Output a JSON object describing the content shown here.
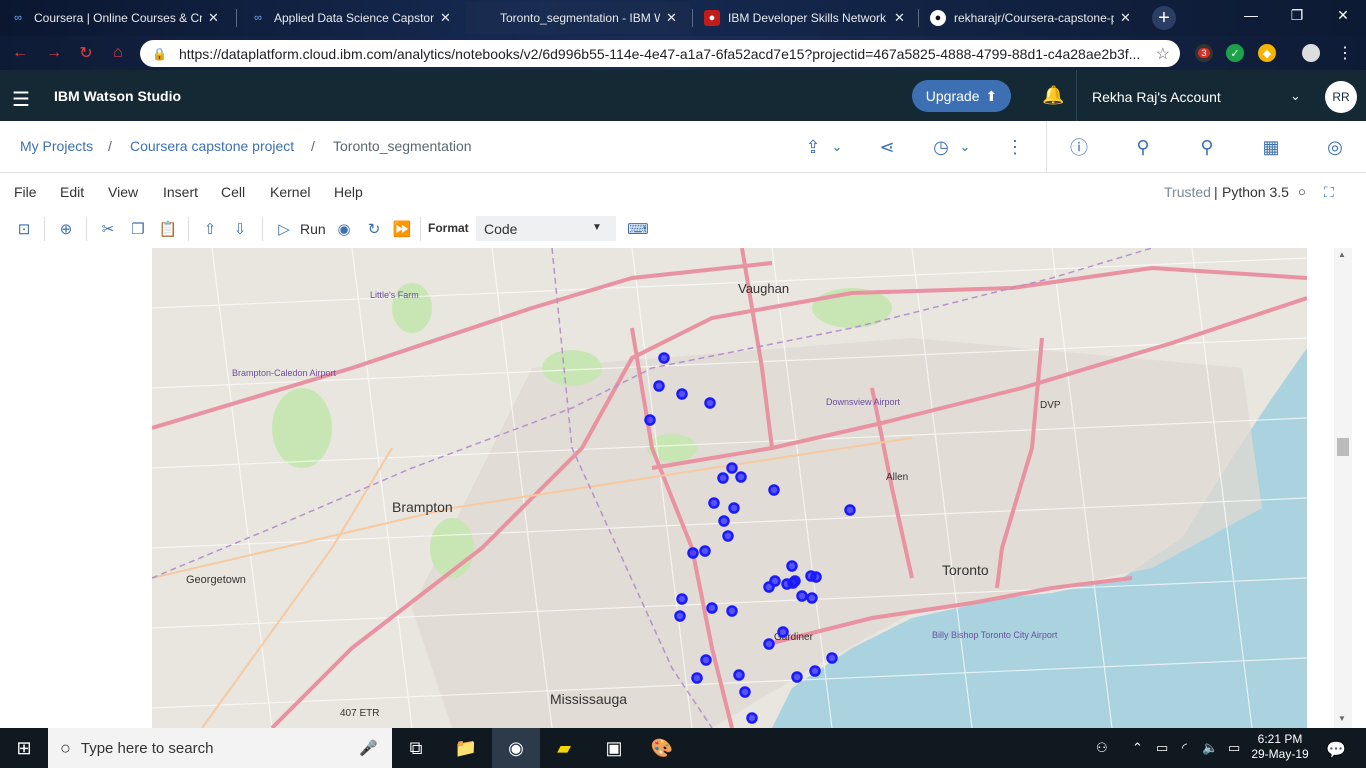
{
  "browser": {
    "tabs": [
      {
        "label": "Coursera | Online Courses & Cr",
        "icon": "coursera-icon"
      },
      {
        "label": "Applied Data Science Capstone",
        "icon": "coursera-icon"
      },
      {
        "label": "Toronto_segmentation - IBM W",
        "icon": "ibm-icon",
        "active": true
      },
      {
        "label": "IBM Developer Skills Network",
        "icon": "ibm-icon"
      },
      {
        "label": "rekharajr/Coursera-capstone-p",
        "icon": "github-icon"
      }
    ],
    "url": "https://dataplatform.cloud.ibm.com/analytics/notebooks/v2/6d996b55-114e-4e47-a1a7-6fa52acd7e15?projectid=467a5825-4888-4799-88d1-c4a28ae2b3f...",
    "ext_badge": "3"
  },
  "app": {
    "brand": "IBM Watson Studio",
    "upgrade_label": "Upgrade",
    "account": "Rekha Raj's Account",
    "avatar": "RR"
  },
  "breadcrumb": {
    "items": [
      "My Projects",
      "Coursera capstone project",
      "Toronto_segmentation"
    ]
  },
  "notebook": {
    "menus": [
      "File",
      "Edit",
      "View",
      "Insert",
      "Cell",
      "Kernel",
      "Help"
    ],
    "trusted": "Trusted",
    "kernel": "Python 3.5",
    "run_label": "Run",
    "format_label": "Format",
    "format_value": "Code"
  },
  "map": {
    "places": [
      {
        "name": "Vaughan"
      },
      {
        "name": "Brampton"
      },
      {
        "name": "Toronto"
      },
      {
        "name": "Mississauga"
      },
      {
        "name": "Georgetown"
      },
      {
        "name": "Little's Farm"
      },
      {
        "name": "Brampton-Caledon Airport"
      },
      {
        "name": "Downsview Airport"
      },
      {
        "name": "Billy Bishop Toronto City Airport"
      },
      {
        "name": "Allen"
      },
      {
        "name": "Gardiner"
      },
      {
        "name": "DVP"
      },
      {
        "name": "407 ETR"
      }
    ],
    "marker_count": 40,
    "marker_color": "#1a1aff"
  },
  "taskbar": {
    "search_placeholder": "Type here to search",
    "time": "6:21 PM",
    "date": "29-May-19"
  }
}
